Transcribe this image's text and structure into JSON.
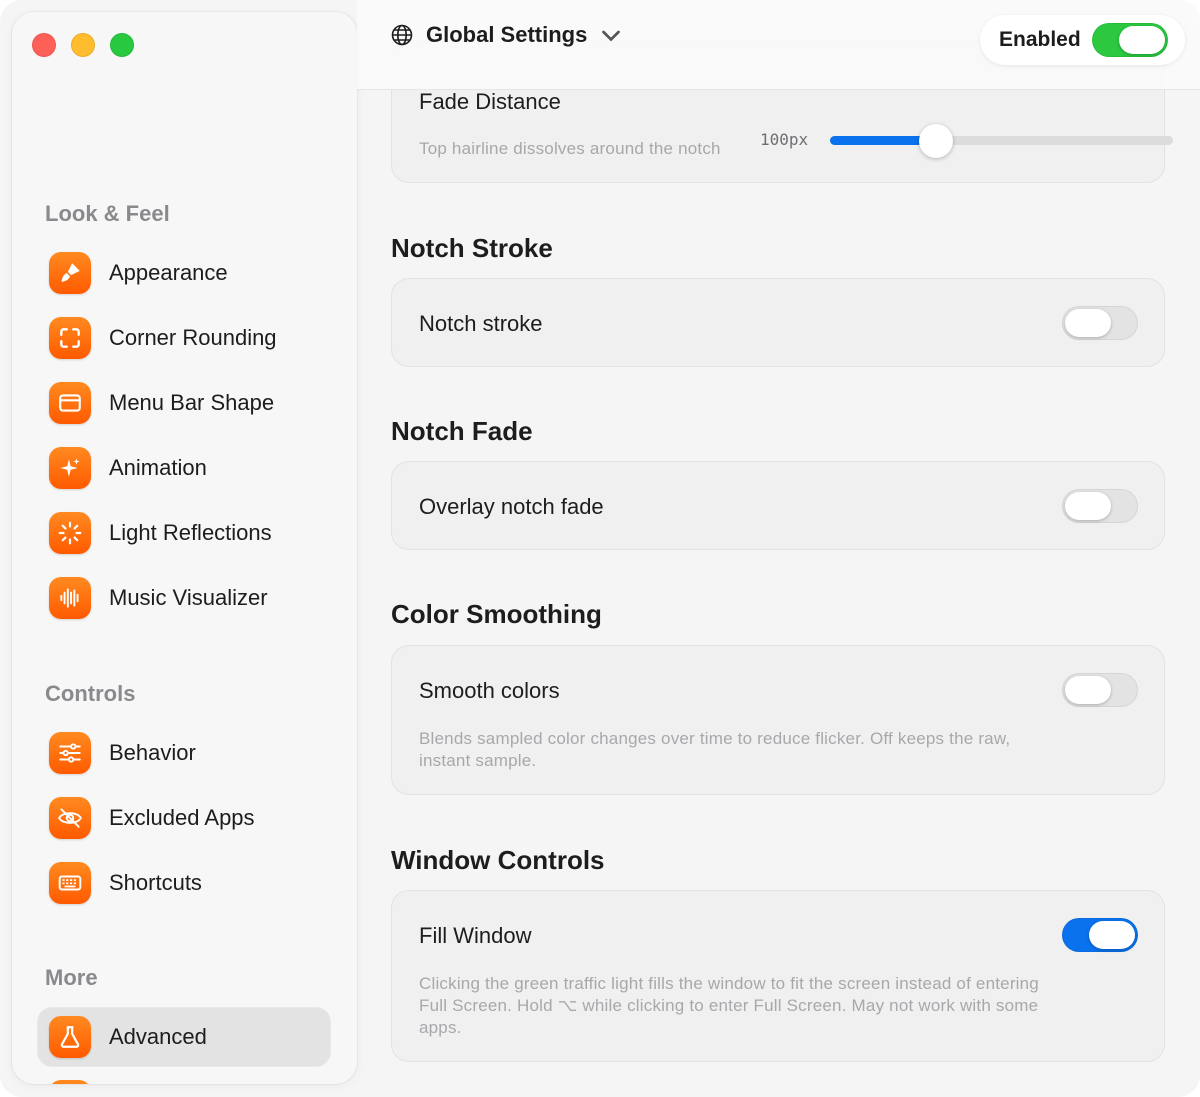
{
  "header": {
    "scope_label": "Global Settings",
    "enabled_label": "Enabled",
    "enabled_on": true
  },
  "sidebar": {
    "sections": [
      {
        "title": "Look & Feel"
      },
      {
        "title": "Controls"
      },
      {
        "title": "More"
      }
    ],
    "items": [
      {
        "label": "Appearance",
        "icon": "paintbrush-icon"
      },
      {
        "label": "Corner Rounding",
        "icon": "corners-icon"
      },
      {
        "label": "Menu Bar Shape",
        "icon": "window-icon"
      },
      {
        "label": "Animation",
        "icon": "sparkles-icon"
      },
      {
        "label": "Light Reflections",
        "icon": "sun-rays-icon"
      },
      {
        "label": "Music Visualizer",
        "icon": "waveform-icon"
      },
      {
        "label": "Behavior",
        "icon": "sliders-icon"
      },
      {
        "label": "Excluded Apps",
        "icon": "eye-slash-icon"
      },
      {
        "label": "Shortcuts",
        "icon": "keyboard-icon"
      },
      {
        "label": "Advanced",
        "icon": "flask-icon",
        "selected": true
      }
    ]
  },
  "main": {
    "fade_distance": {
      "label": "Fade Distance",
      "value_text": "100px",
      "fraction": 0.31,
      "help": "Top hairline dissolves around the notch"
    },
    "notch_stroke": {
      "heading": "Notch Stroke",
      "label": "Notch stroke",
      "on": false
    },
    "notch_fade": {
      "heading": "Notch Fade",
      "label": "Overlay notch fade",
      "on": false
    },
    "color_smoothing": {
      "heading": "Color Smoothing",
      "label": "Smooth colors",
      "on": false,
      "help_line1": "Blends sampled color changes over time to reduce flicker. Off keeps the raw,",
      "help_line2": "instant sample."
    },
    "window_controls": {
      "heading": "Window Controls",
      "label": "Fill Window",
      "on": true,
      "help_line1": "Clicking the green traffic light fills the window to fit the screen instead of entering",
      "help_line2": "Full Screen. Hold ⌥ while clicking to enter Full Screen. May not work with some",
      "help_line3": "apps."
    }
  },
  "colors": {
    "accent_orange": "#ff6a0a",
    "toggle_green": "#2bc840",
    "toggle_blue": "#0a72ec"
  }
}
